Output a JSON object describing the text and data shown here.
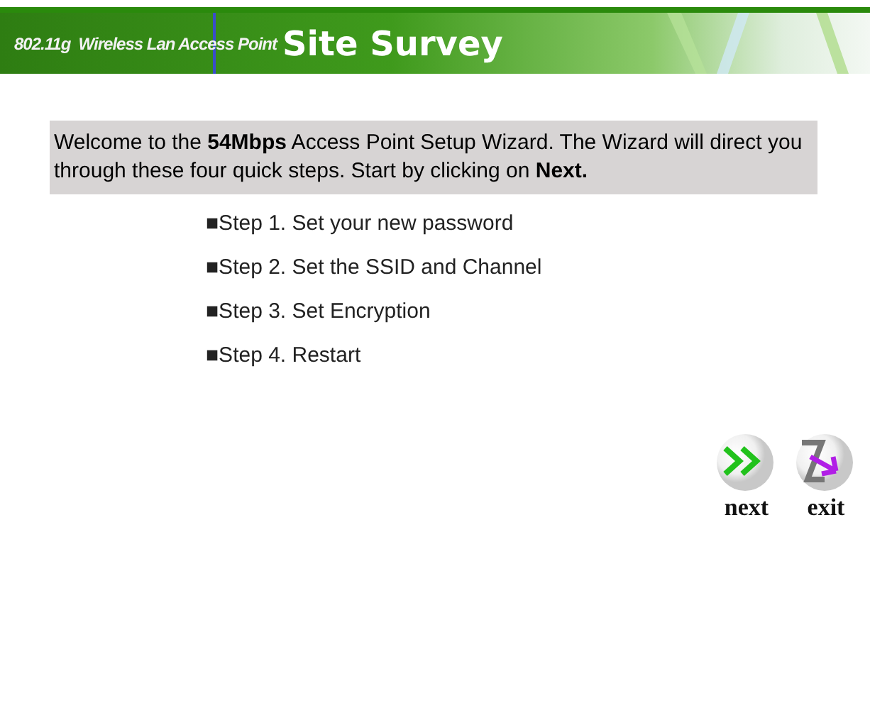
{
  "banner": {
    "product": "802.11g  Wireless Lan Access Point",
    "title": "Site Survey"
  },
  "intro": "Welcome to the **54Mbps** Access Point Setup Wizard. The Wizard will direct you through these four quick steps. Start by clicking on **Next.**",
  "steps": [
    "■Step 1. Set your new password",
    "■Step 2. Set the SSID and Channel",
    "■Step 3. Set Encryption",
    "■Step 4. Restart"
  ],
  "buttons": [
    {
      "kind": "next",
      "label": "next"
    },
    {
      "kind": "exit",
      "label": "exit"
    }
  ]
}
